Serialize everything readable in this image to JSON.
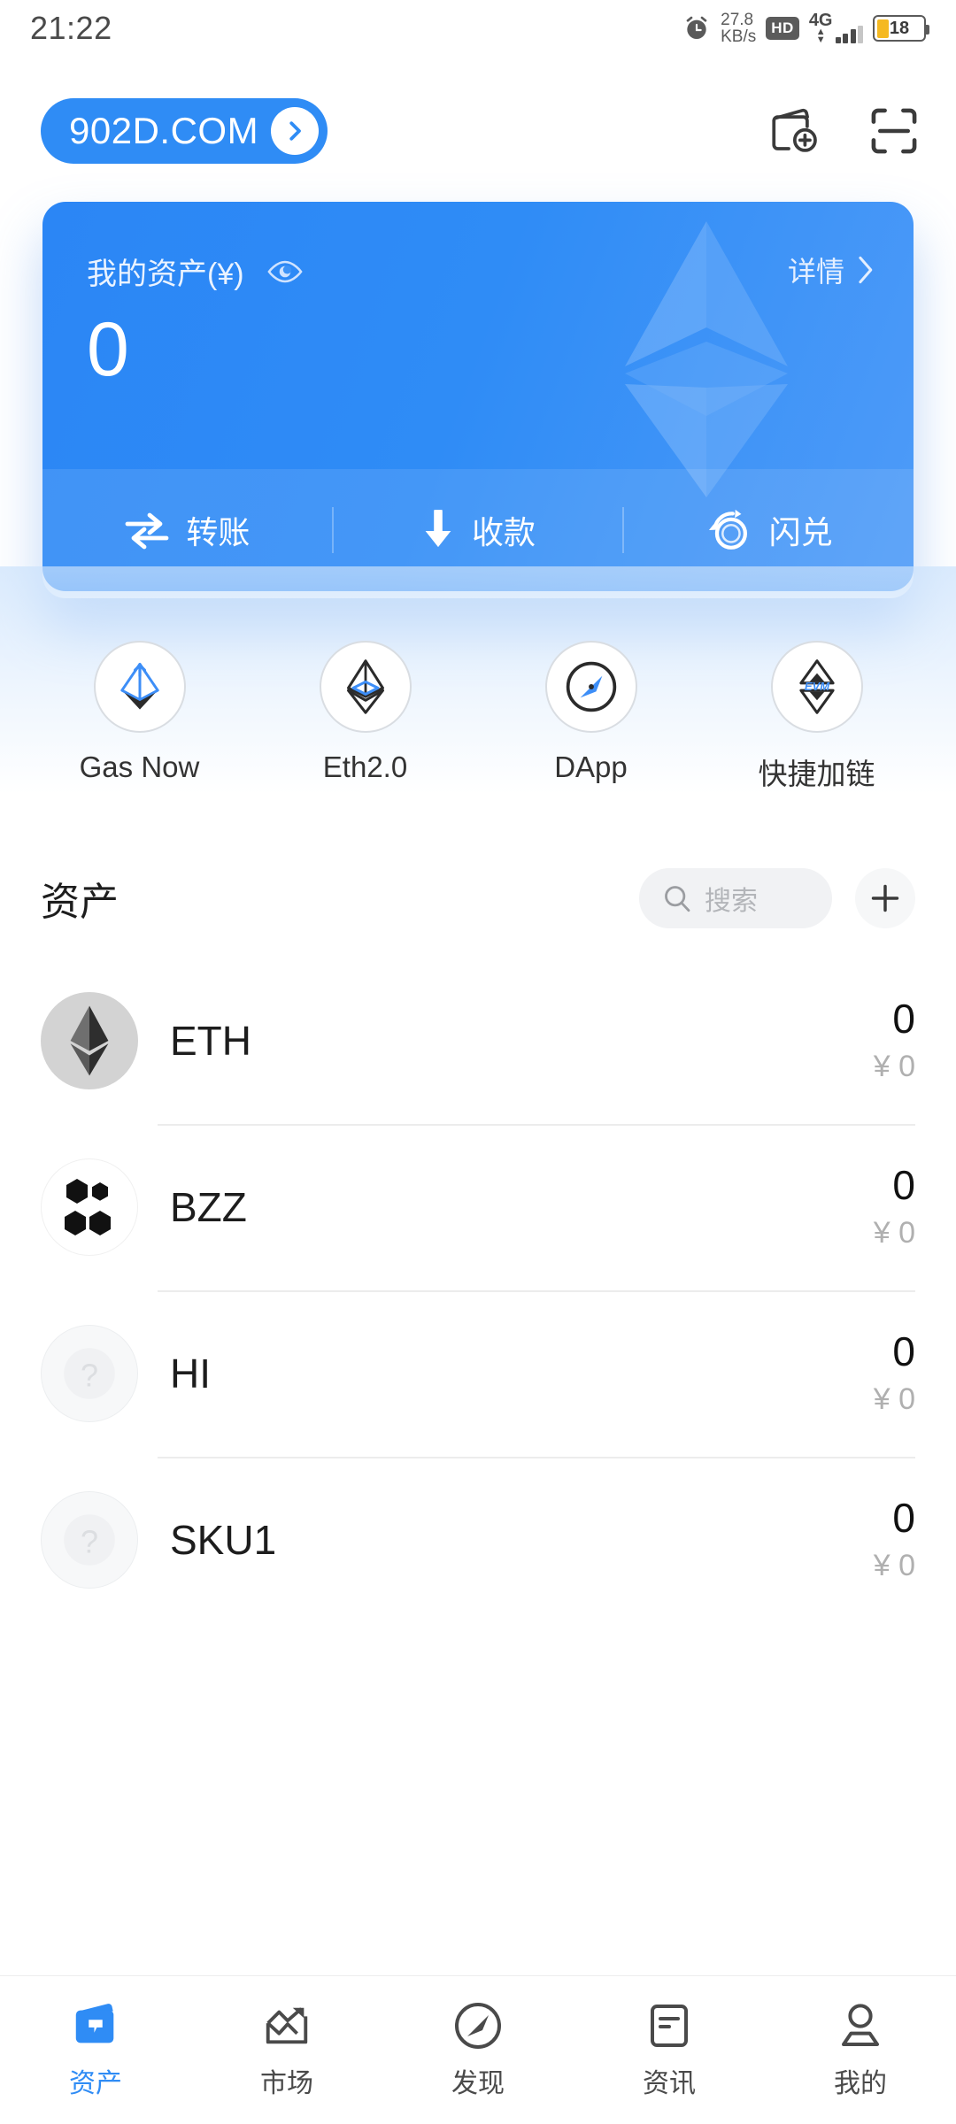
{
  "statusbar": {
    "time": "21:22",
    "net_speed_value": "27.8",
    "net_speed_unit": "KB/s",
    "hd_badge": "HD",
    "network": "4G",
    "battery_percent": "18",
    "alarm_icon": "alarm-clock-icon"
  },
  "header": {
    "wallet_name": "902D.COM",
    "chevron_icon": "chevron-right-icon",
    "add_wallet_icon": "wallet-add-icon",
    "scan_icon": "scan-qr-icon"
  },
  "balance_card": {
    "label": "我的资产(¥)",
    "eye_icon": "eye-icon",
    "amount": "0",
    "details_label": "详情",
    "details_chevron": "chevron-right-icon",
    "watermark_icon": "ethereum-diamond-icon",
    "accent_color": "#2f8cf5",
    "actions": [
      {
        "label": "转账",
        "icon": "transfer-arrows-icon"
      },
      {
        "label": "收款",
        "icon": "arrow-down-icon"
      },
      {
        "label": "闪兑",
        "icon": "flash-swap-icon"
      }
    ]
  },
  "quick_actions": [
    {
      "label": "Gas Now",
      "icon": "gas-now-icon"
    },
    {
      "label": "Eth2.0",
      "icon": "eth2-icon"
    },
    {
      "label": "DApp",
      "icon": "compass-icon"
    },
    {
      "label": "快捷加链",
      "icon": "evm-chain-icon"
    }
  ],
  "assets": {
    "title": "资产",
    "search_placeholder": "搜索",
    "search_value": "",
    "search_icon": "search-icon",
    "add_icon": "plus-icon",
    "rows": [
      {
        "symbol": "ETH",
        "amount": "0",
        "fiat": "¥ 0",
        "icon": "ethereum-token-icon"
      },
      {
        "symbol": "BZZ",
        "amount": "0",
        "fiat": "¥ 0",
        "icon": "swarm-token-icon"
      },
      {
        "symbol": "HI",
        "amount": "0",
        "fiat": "¥ 0",
        "icon": "unknown-token-icon"
      },
      {
        "symbol": "SKU1",
        "amount": "0",
        "fiat": "¥ 0",
        "icon": "unknown-token-icon"
      }
    ]
  },
  "tabbar": {
    "active_color": "#2f8cf5",
    "items": [
      {
        "label": "资产",
        "icon": "wallet-icon",
        "active": true
      },
      {
        "label": "市场",
        "icon": "chart-up-icon",
        "active": false
      },
      {
        "label": "发现",
        "icon": "compass-icon",
        "active": false
      },
      {
        "label": "资讯",
        "icon": "news-icon",
        "active": false
      },
      {
        "label": "我的",
        "icon": "person-icon",
        "active": false
      }
    ]
  }
}
